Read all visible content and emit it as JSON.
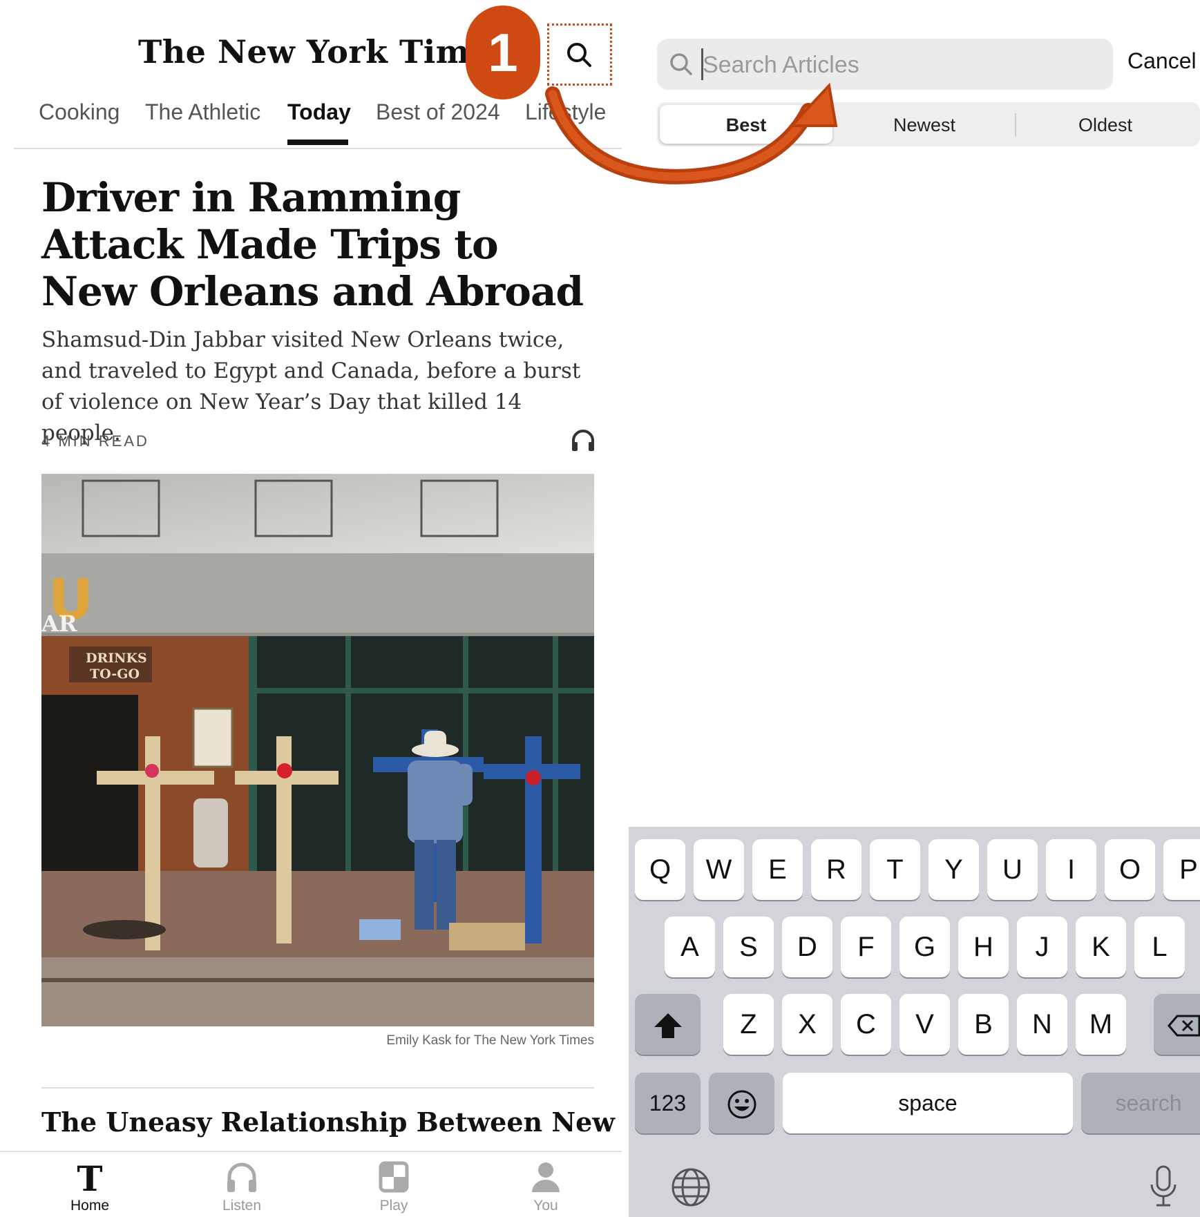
{
  "left": {
    "masthead": "The New York Times",
    "step_badge": "1",
    "sections": [
      "Cooking",
      "The Athletic",
      "Today",
      "Best of 2024",
      "Lifestyle"
    ],
    "active_section": "Today",
    "article": {
      "headline": "Driver in Ramming Attack Made Trips to New Orleans and Abroad",
      "summary": "Shamsud-Din Jabbar visited New Orleans twice, and traveled to Egypt and Canada, before a burst of violence on New Year’s Day that killed 14 people.",
      "read_time": "4 MIN READ",
      "photo_sign_1": "DRINKS",
      "photo_sign_2": "TO-GO",
      "photo_letters": "U",
      "photo_letters_2": "AR",
      "credit": "Emily Kask for The New York Times"
    },
    "next_headline": "The Uneasy Relationship Between New Orleans and Bourbon Street",
    "tabs": [
      {
        "label": "Home",
        "icon": "nyt-t-logo-icon"
      },
      {
        "label": "Listen",
        "icon": "headphones-icon"
      },
      {
        "label": "Play",
        "icon": "games-grid-icon"
      },
      {
        "label": "You",
        "icon": "person-icon"
      }
    ]
  },
  "right": {
    "search_placeholder": "Search Articles",
    "cancel_label": "Cancel",
    "sort_options": [
      "Best",
      "Newest",
      "Oldest"
    ],
    "selected_sort": "Best",
    "keyboard": {
      "row1": [
        "Q",
        "W",
        "E",
        "R",
        "T",
        "Y",
        "U",
        "I",
        "O",
        "P"
      ],
      "row2": [
        "A",
        "S",
        "D",
        "F",
        "G",
        "H",
        "J",
        "K",
        "L"
      ],
      "row3": [
        "Z",
        "X",
        "C",
        "V",
        "B",
        "N",
        "M"
      ],
      "numbers_label": "123",
      "space_label": "space",
      "search_label": "search"
    }
  },
  "colors": {
    "annotation_orange": "#cf4a13",
    "keyboard_bg": "#d2d4d9"
  }
}
